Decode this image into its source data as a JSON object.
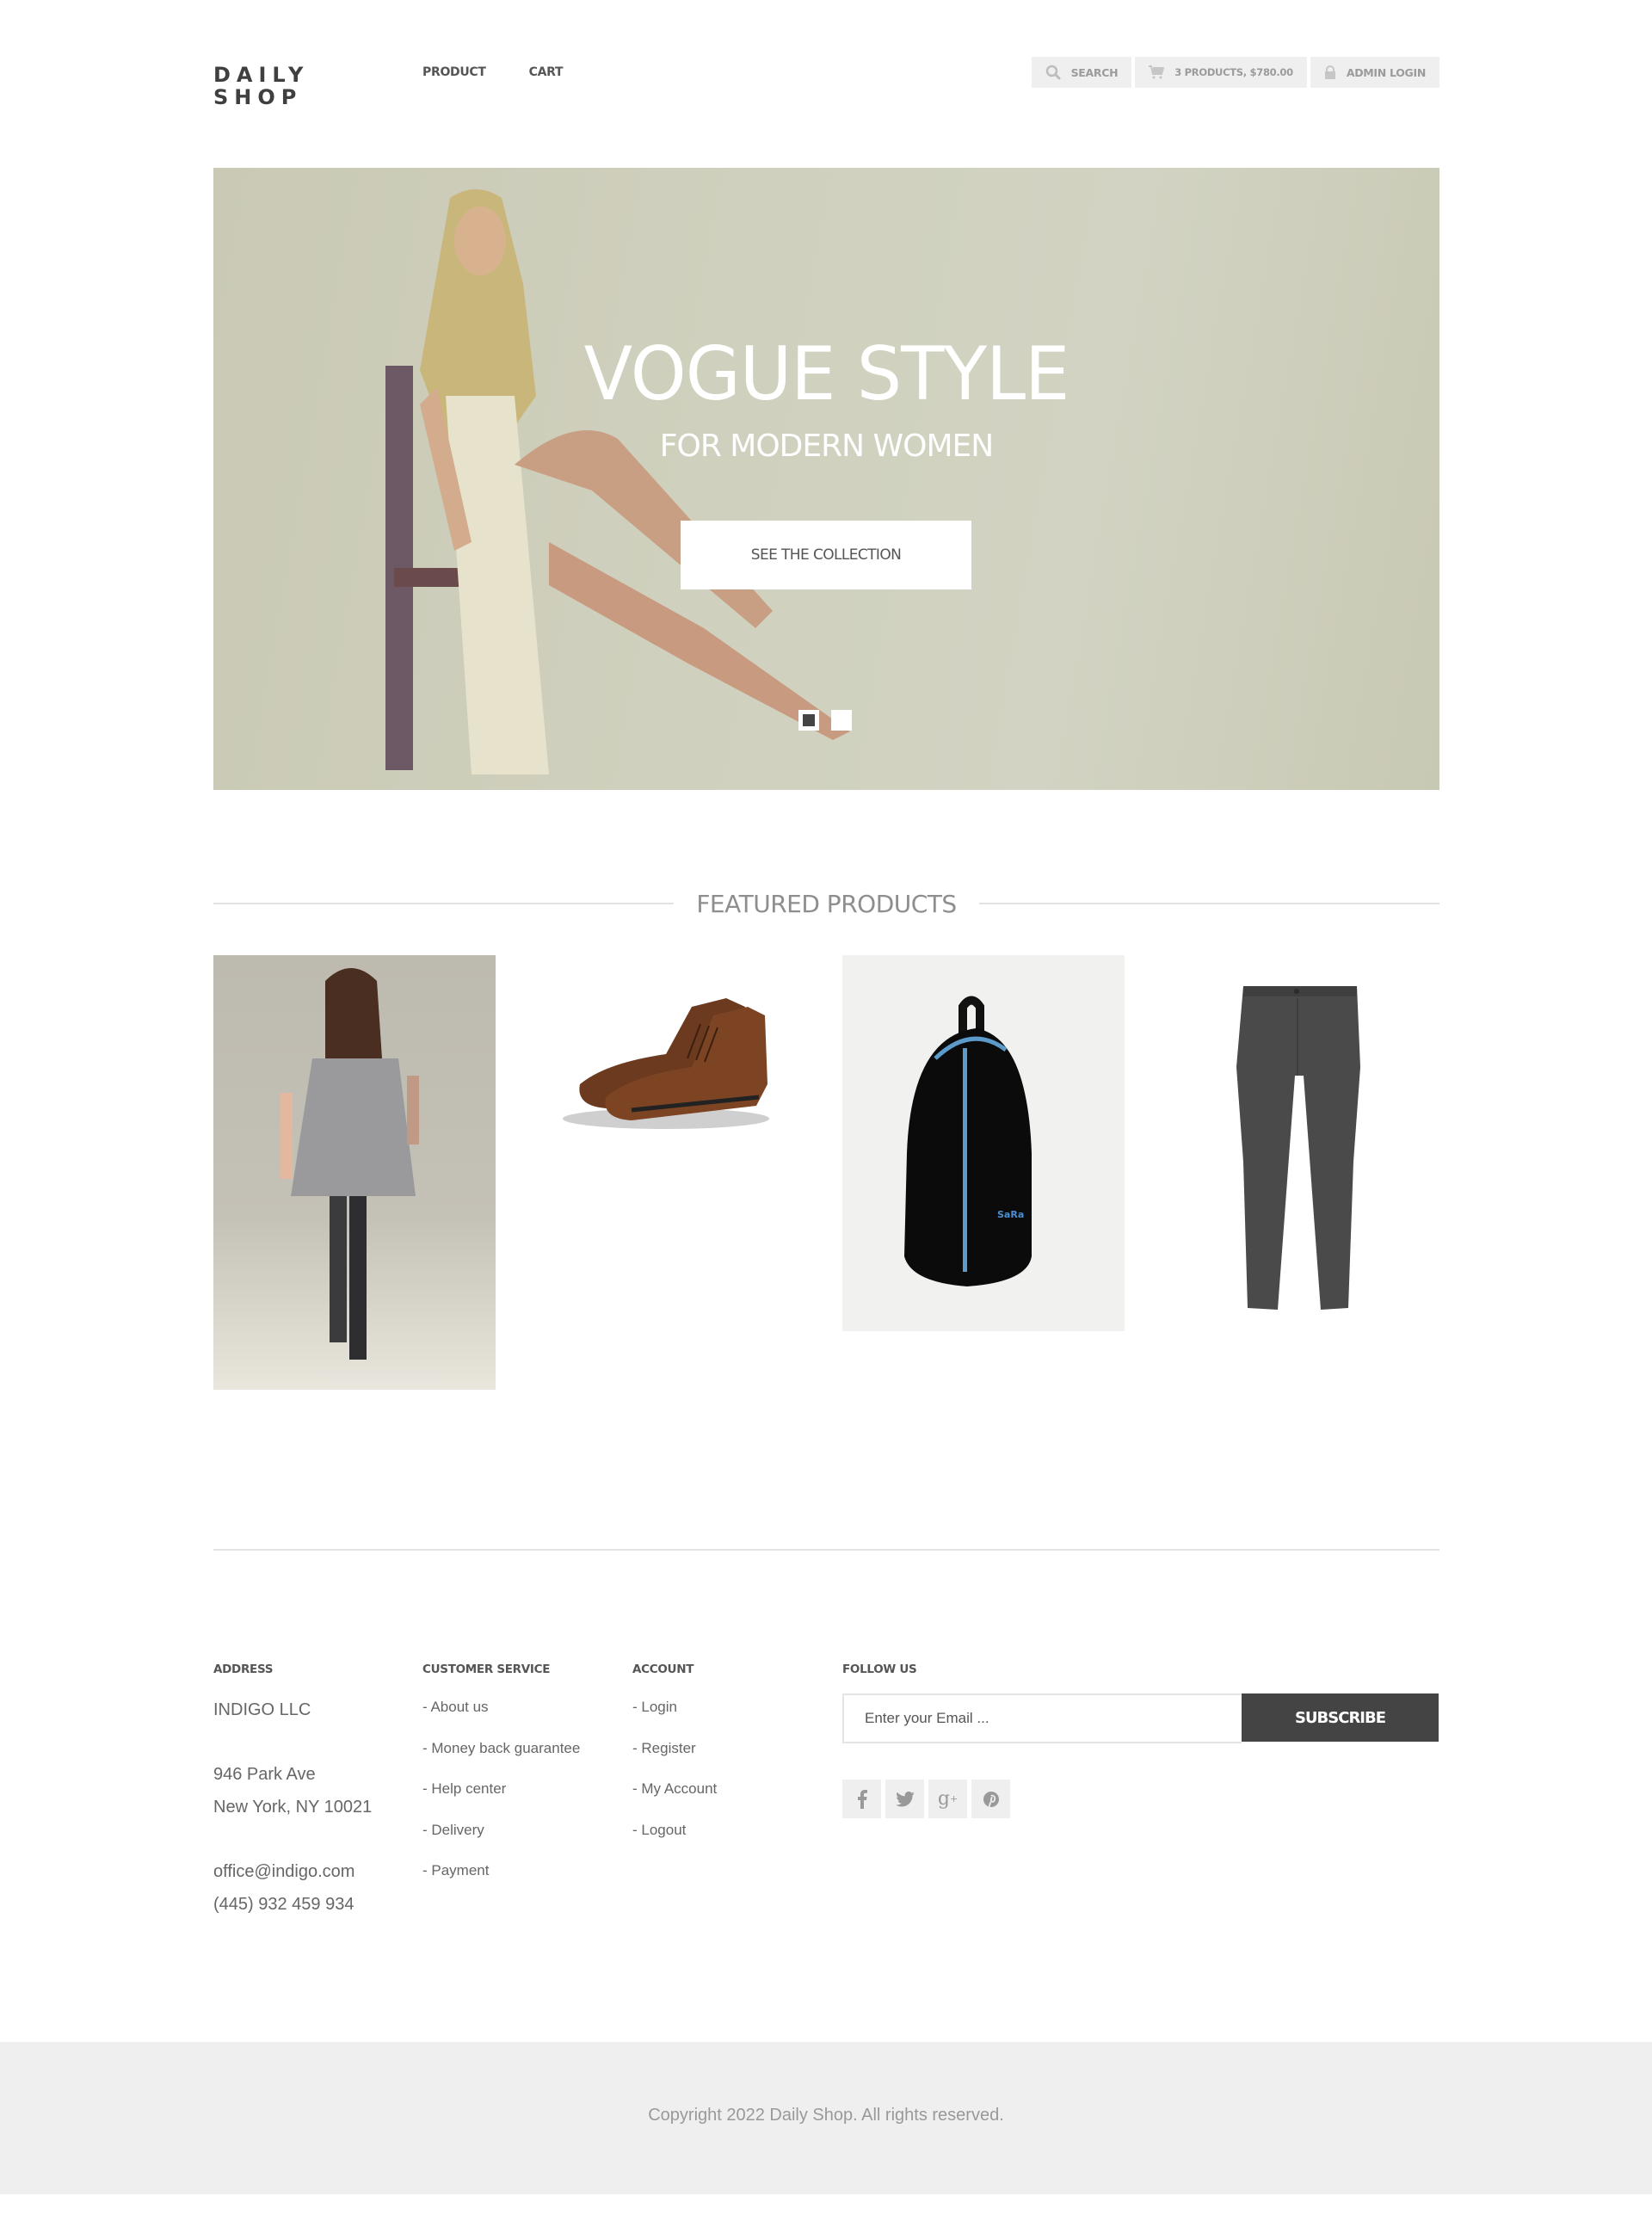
{
  "header": {
    "logo_line1": "DAILY",
    "logo_line2": "SHOP",
    "nav": [
      {
        "label": "PRODUCT"
      },
      {
        "label": "CART"
      }
    ],
    "actions": {
      "search_label": "SEARCH",
      "cart_label": "3 PRODUCTS, $780.00",
      "login_label": "ADMIN LOGIN"
    }
  },
  "hero": {
    "title": "VOGUE STYLE",
    "subtitle": "FOR MODERN WOMEN",
    "button_label": "SEE THE COLLECTION",
    "slides": 2,
    "active_slide": 1
  },
  "featured": {
    "heading": "FEATURED PRODUCTS",
    "products": [
      {
        "name": "Grey dress",
        "image": "woman in grey dress"
      },
      {
        "name": "Brown leather boots",
        "image": "brown leather chukka boots"
      },
      {
        "name": "Black backpack",
        "image": "black backpack with blue zipper",
        "brand_text": "SaRa"
      },
      {
        "name": "Grey trousers",
        "image": "dark grey chino pants"
      }
    ]
  },
  "footer": {
    "address": {
      "heading": "ADDRESS",
      "company": "INDIGO LLC",
      "street": "946 Park Ave",
      "city": "New York, NY 10021",
      "email": "office@indigo.com",
      "phone": "(445) 932 459 934"
    },
    "customer_service": {
      "heading": "CUSTOMER SERVICE",
      "links": [
        "- About us",
        "- Money back guarantee",
        "- Help center",
        "- Delivery",
        "- Payment"
      ]
    },
    "account": {
      "heading": "ACCOUNT",
      "links": [
        "- Login",
        "- Register",
        "- My Account",
        "- Logout"
      ]
    },
    "follow": {
      "heading": "FOLLOW US",
      "email_placeholder": "Enter your Email ...",
      "subscribe_label": "SUBSCRIBE",
      "social": [
        {
          "icon": "facebook-icon",
          "glyph": "f"
        },
        {
          "icon": "twitter-icon",
          "glyph": "t"
        },
        {
          "icon": "google-plus-icon",
          "glyph": "g+"
        },
        {
          "icon": "pinterest-icon",
          "glyph": "p"
        }
      ]
    },
    "copyright": "Copyright 2022 Daily Shop. All rights reserved."
  },
  "colors": {
    "dark_button": "#444444",
    "pill_bg": "#efefef",
    "footer_bg": "#efefef",
    "hero_bg": "#cfd0bd"
  }
}
